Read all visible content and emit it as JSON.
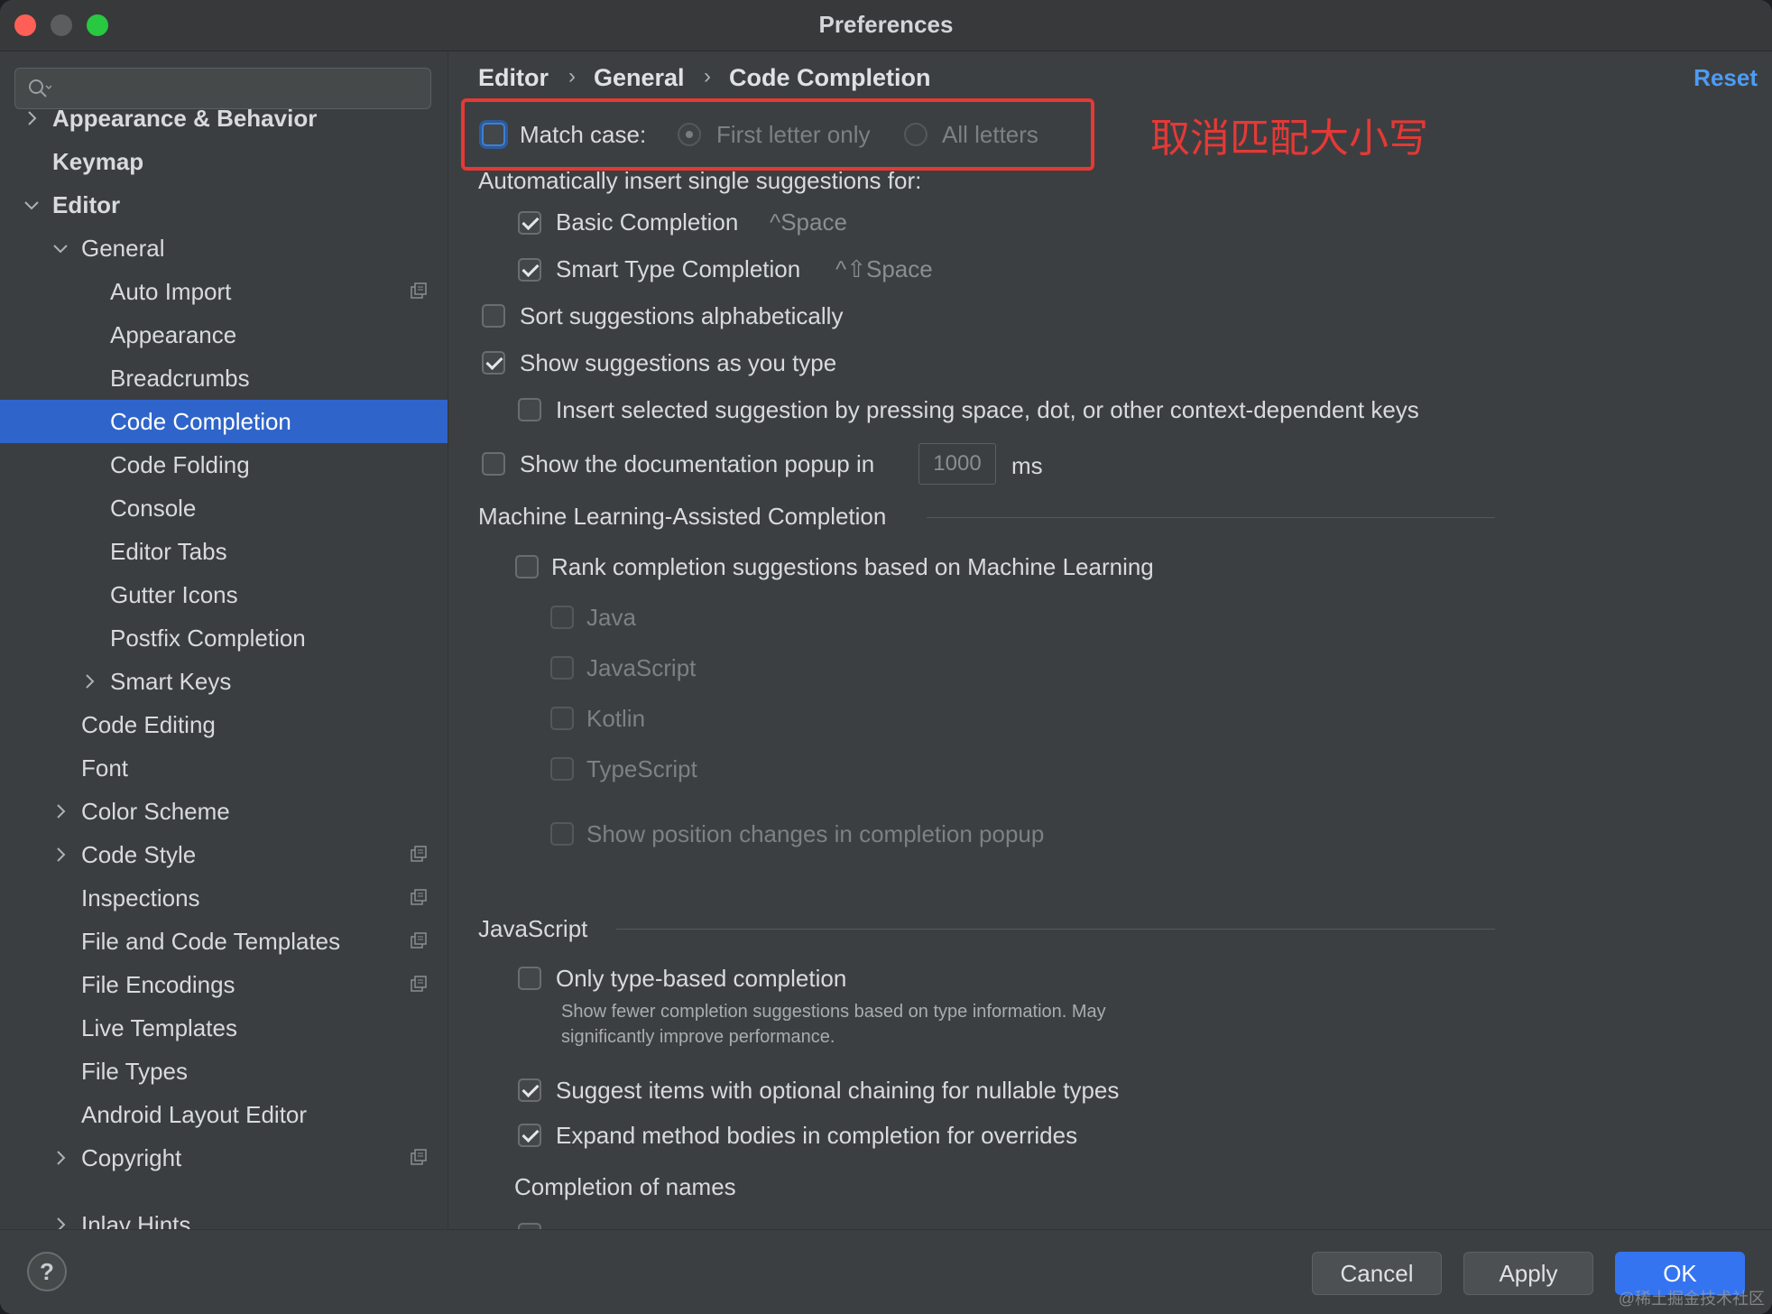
{
  "window": {
    "title": "Preferences"
  },
  "sidebar": {
    "search_placeholder": "",
    "items": [
      {
        "label": "Appearance & Behavior"
      },
      {
        "label": "Keymap"
      },
      {
        "label": "Editor"
      },
      {
        "label": "General"
      },
      {
        "label": "Auto Import"
      },
      {
        "label": "Appearance"
      },
      {
        "label": "Breadcrumbs"
      },
      {
        "label": "Code Completion"
      },
      {
        "label": "Code Folding"
      },
      {
        "label": "Console"
      },
      {
        "label": "Editor Tabs"
      },
      {
        "label": "Gutter Icons"
      },
      {
        "label": "Postfix Completion"
      },
      {
        "label": "Smart Keys"
      },
      {
        "label": "Code Editing"
      },
      {
        "label": "Font"
      },
      {
        "label": "Color Scheme"
      },
      {
        "label": "Code Style"
      },
      {
        "label": "Inspections"
      },
      {
        "label": "File and Code Templates"
      },
      {
        "label": "File Encodings"
      },
      {
        "label": "Live Templates"
      },
      {
        "label": "File Types"
      },
      {
        "label": "Android Layout Editor"
      },
      {
        "label": "Copyright"
      },
      {
        "label": "Inlay Hints"
      }
    ]
  },
  "breadcrumb": {
    "items": [
      "Editor",
      "General",
      "Code Completion"
    ],
    "reset_label": "Reset"
  },
  "match_case": {
    "label": "Match case:",
    "checked": false,
    "options": [
      "First letter only",
      "All letters"
    ],
    "selected": "First letter only"
  },
  "annotation": "取消匹配大小写",
  "auto_insert": {
    "heading": "Automatically insert single suggestions for:",
    "basic": {
      "label": "Basic Completion",
      "shortcut": "^Space",
      "checked": true
    },
    "smart": {
      "label": "Smart Type Completion",
      "shortcut": "^⇧Space",
      "checked": true
    }
  },
  "options": {
    "sort_alpha": {
      "label": "Sort suggestions alphabetically",
      "checked": false
    },
    "show_as_type": {
      "label": "Show suggestions as you type",
      "checked": true
    },
    "insert_selected": {
      "label": "Insert selected suggestion by pressing space, dot, or other context-dependent keys",
      "checked": false
    },
    "doc_popup": {
      "label": "Show the documentation popup in",
      "value": "1000",
      "unit": "ms",
      "checked": false
    }
  },
  "ml": {
    "heading": "Machine Learning-Assisted Completion",
    "rank": {
      "label": "Rank completion suggestions based on Machine Learning",
      "checked": false
    },
    "languages": [
      "Java",
      "JavaScript",
      "Kotlin",
      "TypeScript"
    ],
    "show_position": "Show position changes in completion popup"
  },
  "javascript": {
    "heading": "JavaScript",
    "only_type": {
      "label": "Only type-based completion",
      "checked": false
    },
    "only_type_desc1": "Show fewer completion suggestions based on type information. May",
    "only_type_desc2": "significantly improve performance.",
    "optional_chaining": {
      "label": "Suggest items with optional chaining for nullable types",
      "checked": true
    },
    "expand_bodies": {
      "label": "Expand method bodies in completion for overrides",
      "checked": true
    },
    "completion_names": "Completion of names"
  },
  "buttons": {
    "help": "?",
    "cancel": "Cancel",
    "apply": "Apply",
    "ok": "OK"
  },
  "watermark": "@稀土掘金技术社区",
  "colors": {
    "accent": "#2f65ca",
    "annotation": "#e53935",
    "link": "#4d9cf5"
  }
}
